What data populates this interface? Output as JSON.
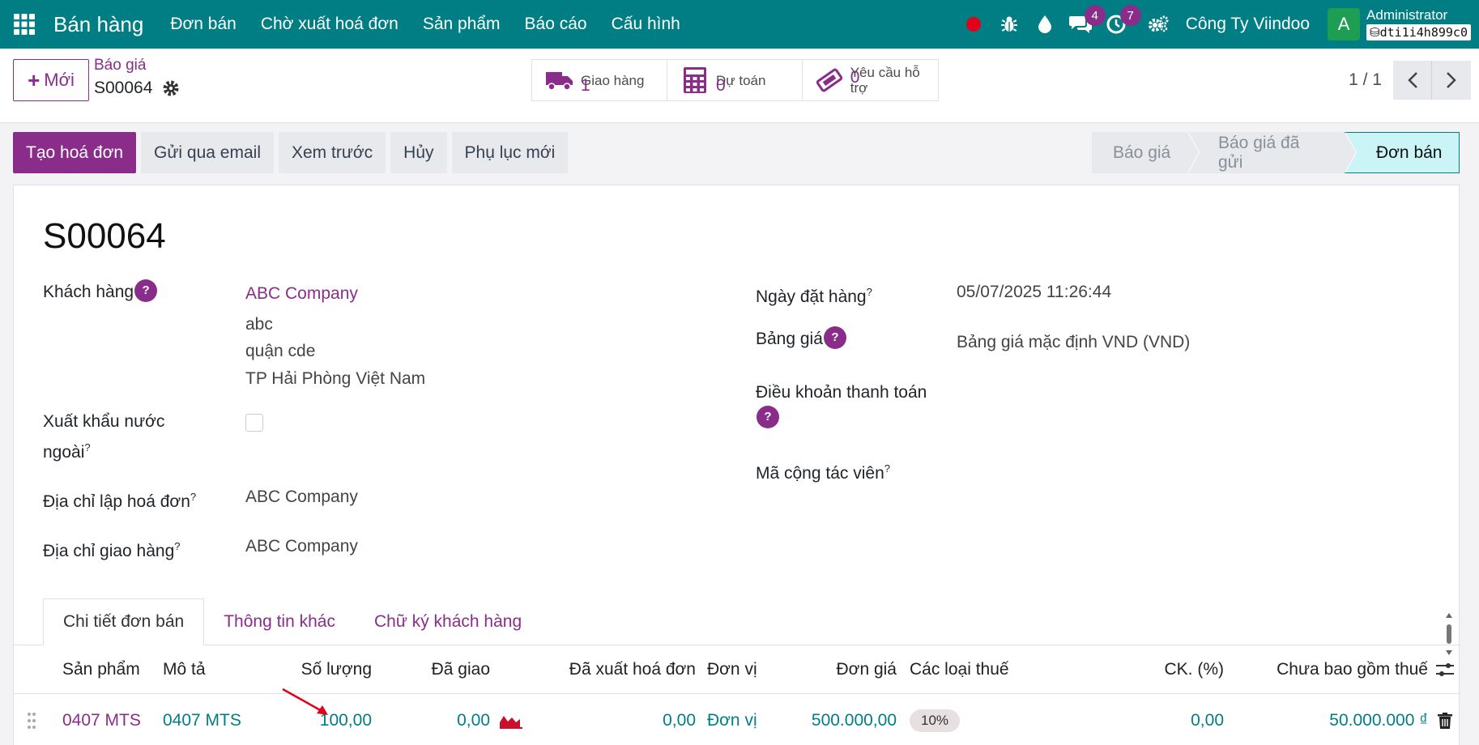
{
  "navbar": {
    "app_name": "Bán hàng",
    "menu": [
      "Đơn bán",
      "Chờ xuất hoá đơn",
      "Sản phẩm",
      "Báo cáo",
      "Cấu hình"
    ],
    "messages_badge": "4",
    "activities_badge": "7",
    "company": "Công Ty Viindoo",
    "avatar_letter": "A",
    "user_name": "Administrator",
    "database": "dti1i4h899c0"
  },
  "control": {
    "new_label": "Mới",
    "breadcrumb_parent": "Báo giá",
    "breadcrumb_current": "S00064",
    "smart_buttons": [
      {
        "label": "Giao hàng",
        "value": "1",
        "icon": "truck-icon"
      },
      {
        "label": "Dự toán",
        "value": "0",
        "icon": "calculator-icon"
      },
      {
        "label": "Yêu cầu hỗ trợ",
        "value": "0",
        "icon": "ticket-icon"
      }
    ],
    "pager": "1 / 1"
  },
  "statusbar": {
    "actions": [
      "Tạo hoá đơn",
      "Gửi qua email",
      "Xem trước",
      "Hủy",
      "Phụ lục mới"
    ],
    "stages": [
      "Báo giá",
      "Báo giá đã gửi",
      "Đơn bán"
    ],
    "active_stage": "Đơn bán"
  },
  "form": {
    "title": "S00064",
    "customer_label": "Khách hàng",
    "customer_name": "ABC Company",
    "customer_address": [
      "abc",
      "quận cde",
      "TP Hải Phòng Việt Nam"
    ],
    "export_label_line1": "Xuất khẩu nước",
    "export_label_line2": "ngoài",
    "invoice_address_label": "Địa chỉ lập hoá đơn",
    "invoice_address": "ABC Company",
    "delivery_address_label": "Địa chỉ giao hàng",
    "delivery_address": "ABC Company",
    "order_date_label": "Ngày đặt hàng",
    "order_date": "05/07/2025 11:26:44",
    "pricelist_label": "Bảng giá",
    "pricelist": "Bảng giá mặc định VND (VND)",
    "payment_terms_label": "Điều khoản thanh toán",
    "referrer_label": "Mã cộng tác viên",
    "help_mark": "?",
    "sup_mark": "?"
  },
  "tabs": [
    "Chi tiết đơn bán",
    "Thông tin khác",
    "Chữ ký khách hàng"
  ],
  "table": {
    "columns": [
      "Sản phẩm",
      "Mô tả",
      "Số lượng",
      "Đã giao",
      "Đã xuất hoá đơn",
      "Đơn vị",
      "Đơn giá",
      "Các loại thuế",
      "CK. (%)",
      "Chưa bao gồm thuế"
    ],
    "rows": [
      {
        "product": "0407 MTS",
        "description": "0407 MTS",
        "quantity": "100,00",
        "delivered": "0,00",
        "invoiced": "0,00",
        "uom": "Đơn vị",
        "unit_price": "500.000,00",
        "tax": "10%",
        "discount": "0,00",
        "subtotal": "50.000.000 ₫"
      }
    ]
  }
}
